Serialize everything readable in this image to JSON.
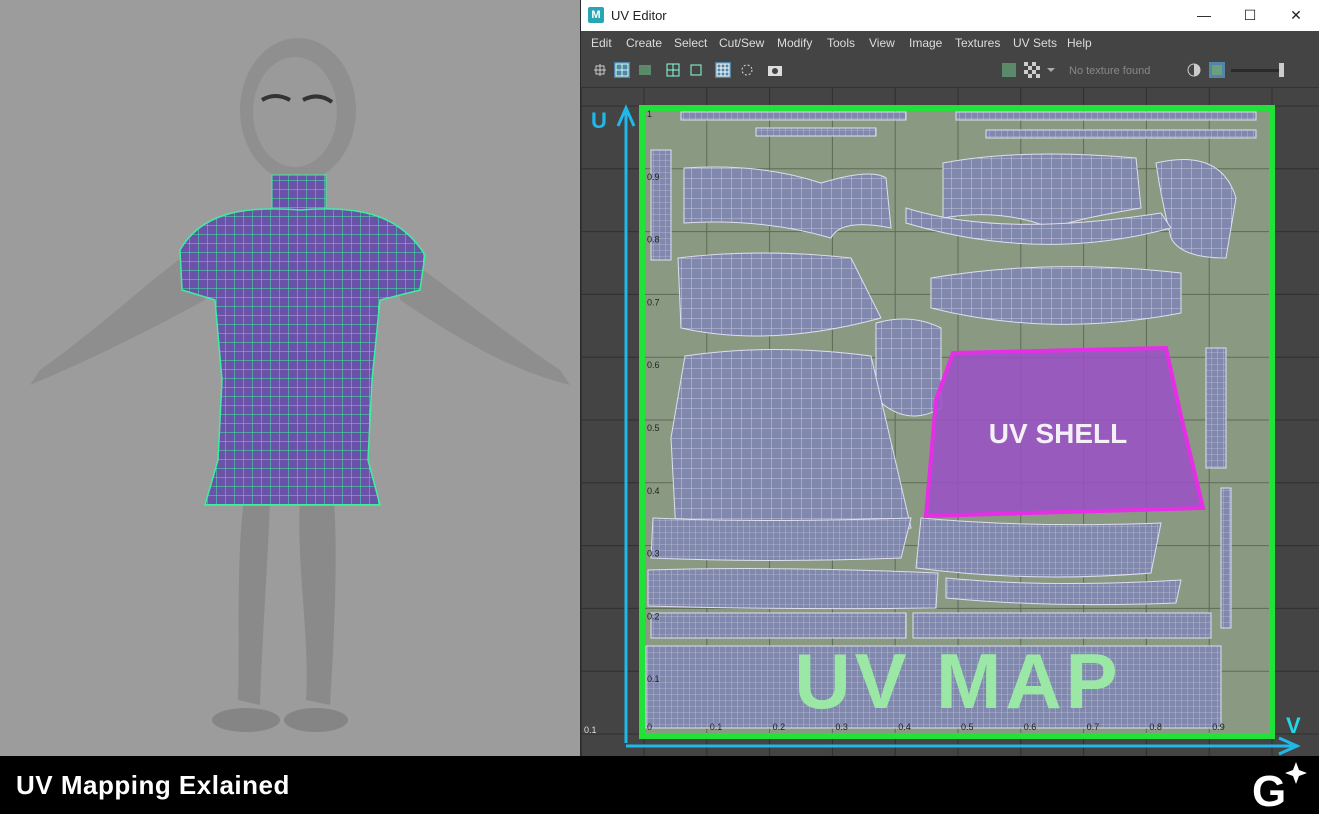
{
  "window": {
    "app_logo": "M",
    "title": "UV Editor",
    "minimize_glyph": "—",
    "maximize_glyph": "☐",
    "close_glyph": "✕"
  },
  "menu": [
    "Edit",
    "Create",
    "Select",
    "Cut/Sew",
    "Modify",
    "Tools",
    "View",
    "Image",
    "Textures",
    "UV Sets",
    "Help"
  ],
  "toolbar": {
    "texture_status": "No texture found"
  },
  "uv_grid": {
    "row_labels": [
      "1",
      "0.9",
      "0.8",
      "0.7",
      "0.6",
      "0.5",
      "0.4",
      "0.3",
      "0.2",
      "0.1"
    ],
    "col_labels": [
      "0",
      "0.1",
      "0.2",
      "0.3",
      "0.4",
      "0.5",
      "0.6",
      "0.7",
      "0.8",
      "0.9"
    ],
    "corner_label": "0.1"
  },
  "annotations": {
    "u_axis": "U",
    "v_axis": "V",
    "uv_shell": "UV SHELL",
    "uv_map": "UV MAP"
  },
  "colors": {
    "uv_frame": "#22e23a",
    "axis": "#1fb8e8",
    "shell": "#e62ee6",
    "mesh_wire": "#3cf0a0",
    "uv_map_text": "#9be7a6"
  },
  "footer": {
    "caption": "UV Mapping Exlained",
    "brand_letter": "G"
  }
}
